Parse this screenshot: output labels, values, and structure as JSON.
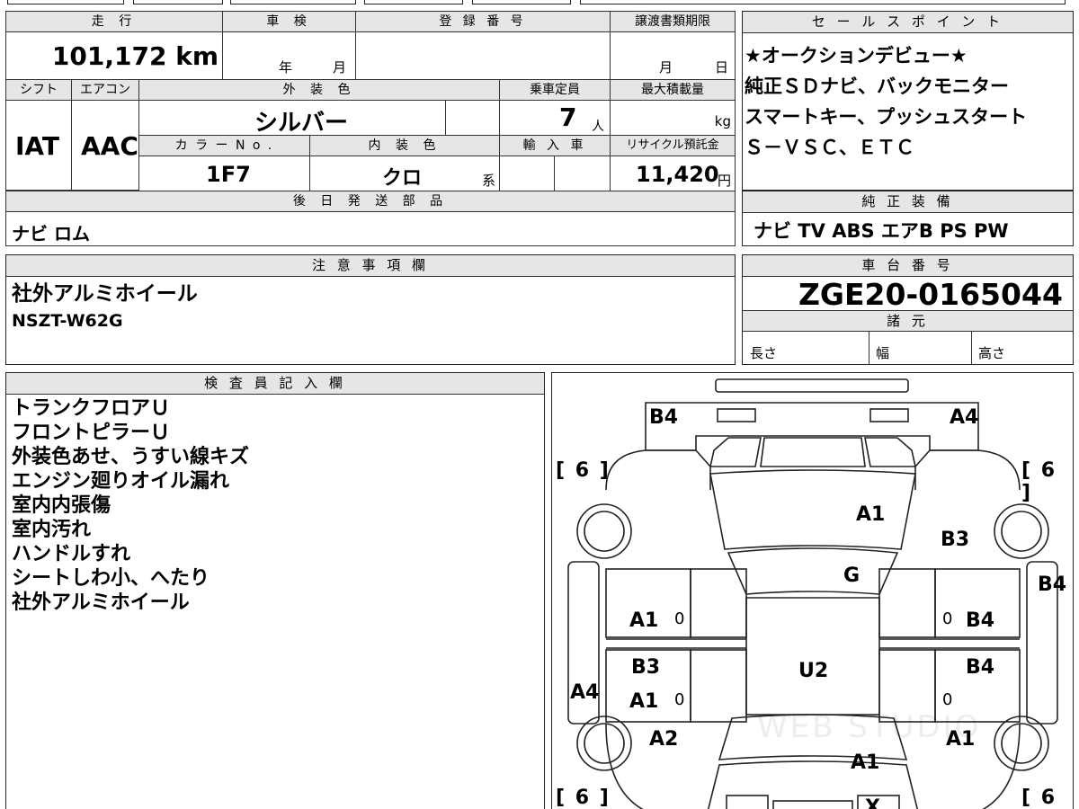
{
  "top_form": {
    "mileage_header": "走 行",
    "mileage_value": "101,172 km",
    "shaken_header": "車 検",
    "shaken_year_unit": "年",
    "shaken_month_unit": "月",
    "reg_number_header": "登 録 番 号",
    "transfer_deadline_header": "譲渡書類期限",
    "transfer_month_unit": "月",
    "transfer_day_unit": "日",
    "shift_header": "シフト",
    "shift_value": "IAT",
    "aircon_header": "エアコン",
    "aircon_value": "AAC",
    "exterior_color_header": "外 装 色",
    "exterior_color_value": "シルバー",
    "capacity_header": "乗車定員",
    "capacity_value": "7",
    "capacity_unit": "人",
    "max_load_header": "最大積載量",
    "max_load_unit": "kg",
    "color_no_header": "カ ラ ー N o .",
    "color_no_value": "1F7",
    "interior_color_header": "内 装 色",
    "interior_color_value": "クロ",
    "interior_color_suffix": "系",
    "import_header": "輸 入 車",
    "recycle_header": "リサイクル預託金",
    "recycle_value": "11,420",
    "recycle_unit": "円",
    "later_parts_header": "後 日 発 送 部 品",
    "later_parts_value": "ナビ ロム"
  },
  "sales_points": {
    "header": "セ ー ル ス ポ イ ン ト",
    "lines": [
      "★オークションデビュー★",
      "純正ＳＤナビ、バックモニター",
      "スマートキー、プッシュスタート",
      "Ｓ－ＶＳＣ、ＥＴＣ"
    ]
  },
  "standard_equipment": {
    "header": "純 正 装 備",
    "value": "ナビ TV ABS エアB PS PW"
  },
  "notes": {
    "header": "注 意 事 項 欄",
    "lines": [
      "社外アルミホイール",
      "NSZT-W62G"
    ]
  },
  "chassis": {
    "header": "車 台 番 号",
    "value": "ZGE20-0165044",
    "specs_header": "諸 元",
    "length_label": "長さ",
    "width_label": "幅",
    "height_label": "高さ"
  },
  "inspector": {
    "header": "検 査 員 記 入 欄",
    "lines": [
      "トランクフロアＵ",
      "フロントピラーＵ",
      "外装色あせ、うすい線キズ",
      "エンジン廻りオイル漏れ",
      "室内内張傷",
      "室内汚れ",
      "ハンドルすれ",
      "シートしわ小、へたり",
      "社外アルミホイール"
    ]
  },
  "diagram": {
    "marks": {
      "b4_rear_left": "B4",
      "a4_rear_right": "A4",
      "a1_roof_rear": "A1",
      "b3_right_rear_quarter": "B3",
      "g_windshield": "G",
      "b4_right_side": "B4",
      "a1_left_rear_door": "A1",
      "b4_right_rear_door": "B4",
      "u2_roof": "U2",
      "b3_left_front_door": "B3",
      "b4_right_front_door": "B4",
      "a4_left_side": "A4",
      "a1_left_front_door": "A1",
      "a2_left_front_fender": "A2",
      "a1_right_front_fender": "A1",
      "a1_hood": "A1",
      "x_front_bumper": "X",
      "zero_1": "0",
      "zero_2": "0",
      "zero_3": "0",
      "zero_4": "0"
    },
    "tire_tread": "6",
    "watermark": "WEB STUDIO"
  }
}
